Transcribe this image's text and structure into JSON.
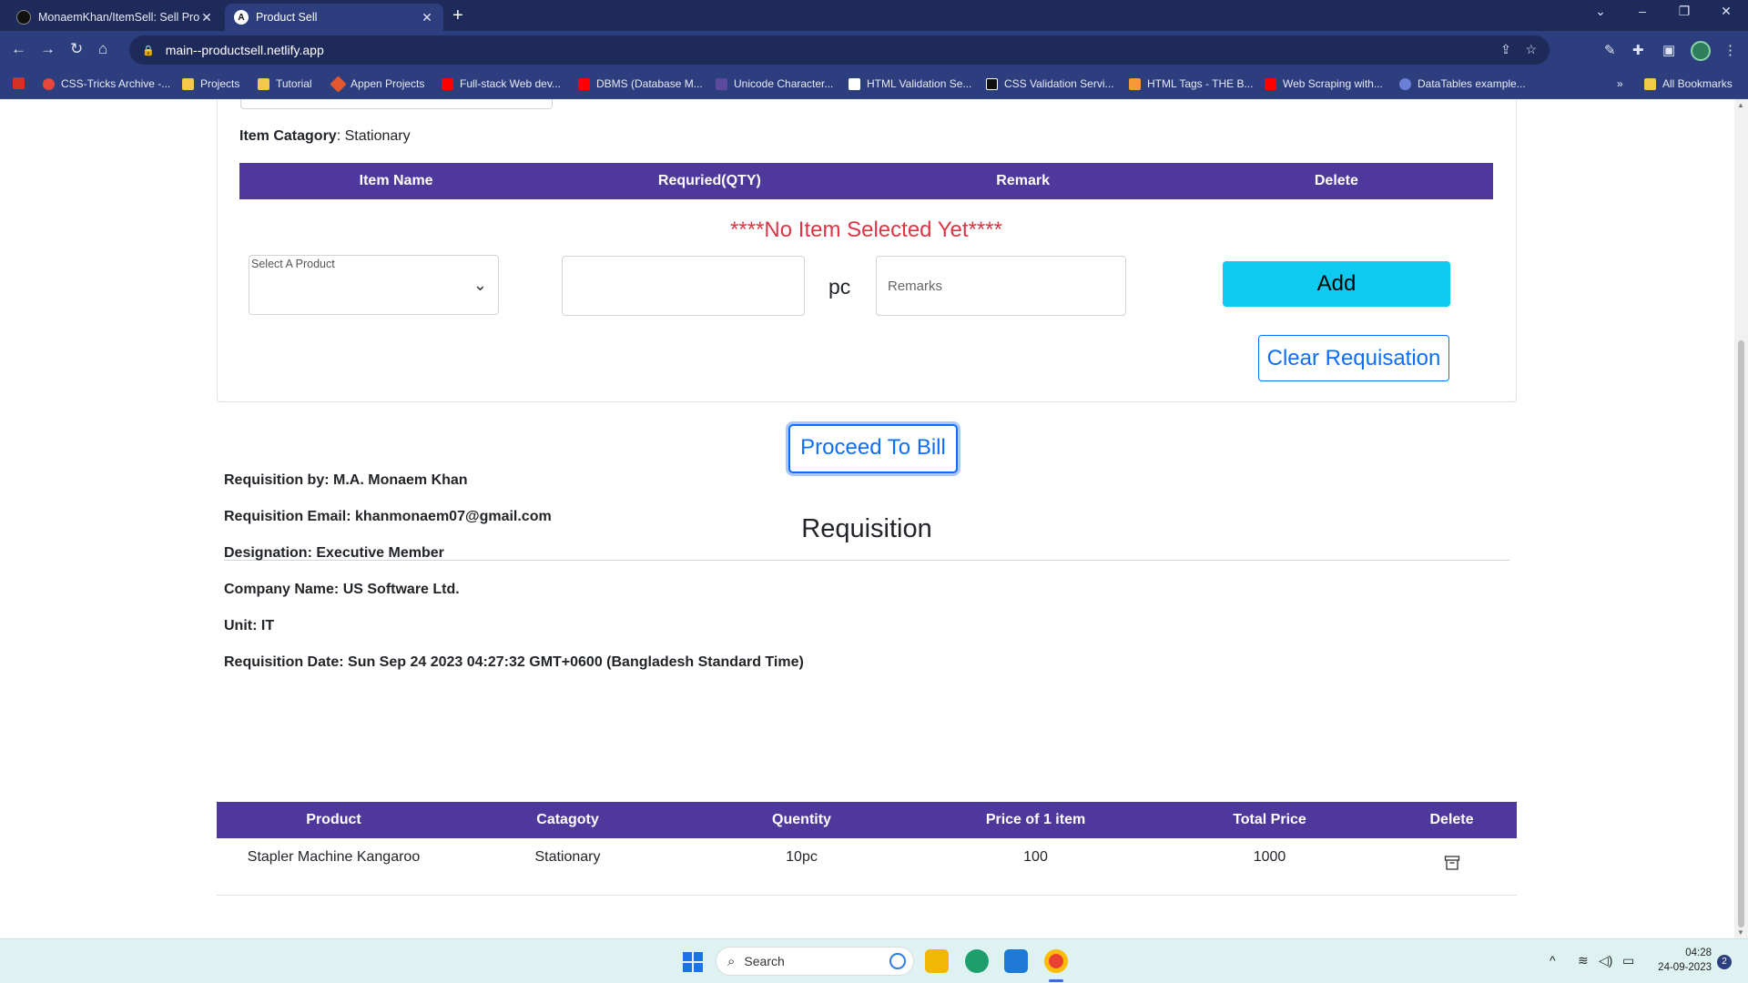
{
  "browser": {
    "tabs": [
      {
        "title": "MonaemKhan/ItemSell: Sell Prod",
        "active": false
      },
      {
        "title": "Product Sell",
        "active": true,
        "favicon_letter": "A"
      }
    ],
    "url": "main--productsell.netlify.app",
    "bookmarks": [
      {
        "label": "CSS-Tricks Archive -...",
        "icon": "css-tricks-icon"
      },
      {
        "label": "Projects",
        "icon": "folder-icon"
      },
      {
        "label": "Tutorial",
        "icon": "folder-icon"
      },
      {
        "label": "Appen Projects",
        "icon": "appen-icon"
      },
      {
        "label": "Full-stack Web dev...",
        "icon": "youtube-icon"
      },
      {
        "label": "DBMS (Database M...",
        "icon": "youtube-icon"
      },
      {
        "label": "Unicode Character...",
        "icon": "unicode-icon"
      },
      {
        "label": "HTML Validation Se...",
        "icon": "w3c-icon"
      },
      {
        "label": "CSS Validation Servi...",
        "icon": "css-validator-icon"
      },
      {
        "label": "HTML Tags - THE B...",
        "icon": "html-tags-icon"
      },
      {
        "label": "Web Scraping with...",
        "icon": "youtube-icon"
      },
      {
        "label": "DataTables example...",
        "icon": "datatables-icon"
      }
    ],
    "all_bookmarks": "All Bookmarks"
  },
  "form": {
    "item_category_label": "Item Catagory",
    "item_category_value": "Stationary",
    "table_headers": [
      "Item Name",
      "Requried(QTY)",
      "Remark",
      "Delete"
    ],
    "empty_message": "****No Item Selected Yet****",
    "product_select_placeholder": "Select A Product",
    "qty_value": "",
    "unit": "pc",
    "remarks_placeholder": "Remarks",
    "add_label": "Add",
    "clear_label": "Clear Requisation"
  },
  "proceed_label": "Proceed To Bill",
  "requisition": {
    "title": "Requisition",
    "fields": [
      {
        "label": "Requisition by:",
        "value": "M.A. Monaem Khan"
      },
      {
        "label": "Requisition Email:",
        "value": "khanmonaem07@gmail.com"
      },
      {
        "label": "Designation:",
        "value": "Executive Member"
      },
      {
        "label": "Company Name:",
        "value": "US Software Ltd."
      },
      {
        "label": "Unit:",
        "value": "IT"
      },
      {
        "label": "Requisition Date:",
        "value": "Sun Sep 24 2023 04:27:32 GMT+0600 (Bangladesh Standard Time)"
      }
    ]
  },
  "bill": {
    "headers": [
      "Product",
      "Catagoty",
      "Quentity",
      "Price of 1 item",
      "Total Price",
      "Delete"
    ],
    "rows": [
      {
        "product": "Stapler Machine Kangaroo",
        "category": "Stationary",
        "quantity": "10pc",
        "price": "100",
        "total": "1000"
      }
    ]
  },
  "taskbar": {
    "search_placeholder": "Search",
    "time": "04:28",
    "date": "24-09-2023",
    "notifications": "2"
  },
  "colors": {
    "table_header": "#4f389c",
    "danger": "#dc3545",
    "info": "#0dcaf0",
    "primary": "#0d6efd"
  }
}
